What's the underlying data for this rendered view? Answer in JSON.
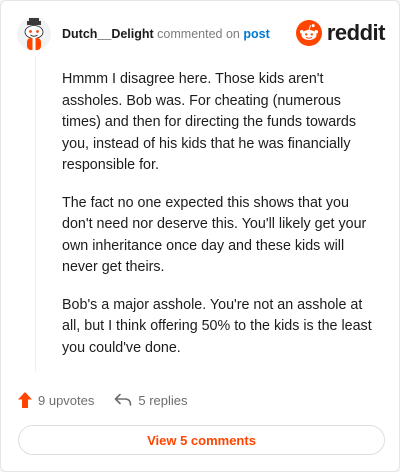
{
  "header": {
    "username": "Dutch__Delight",
    "action_text": "commented on",
    "link_text": "post",
    "brand": "reddit"
  },
  "comment": {
    "paragraphs": [
      "Hmmm I disagree here. Those kids aren't assholes. Bob was. For cheating (numerous times) and then for directing the funds towards you, instead of his kids that he was financially responsible for.",
      "The fact no one expected this shows that you don't need nor deserve this. You'll likely get your own inheritance once day and these kids will never get theirs.",
      "Bob's a major asshole. You're not an asshole at all, but I think offering 50% to the kids is the least you could've done."
    ]
  },
  "actions": {
    "upvotes_label": "9 upvotes",
    "replies_label": "5 replies"
  },
  "footer": {
    "view_comments_label": "View 5 comments"
  },
  "colors": {
    "brand_orange": "#ff4500",
    "link_blue": "#0079d3"
  },
  "icons": [
    "avatar-snoo-icon",
    "reddit-logo-icon",
    "upvote-arrow-icon",
    "reply-arrow-icon"
  ]
}
